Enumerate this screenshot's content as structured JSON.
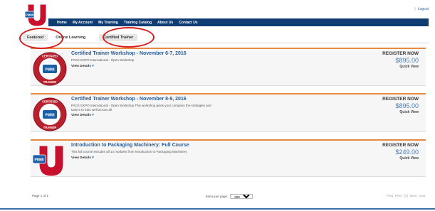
{
  "header": {
    "logout_label": "Logout",
    "nav": [
      {
        "label": "Home"
      },
      {
        "label": "My Account"
      },
      {
        "label": "My Training"
      },
      {
        "label": "Training Catalog"
      },
      {
        "label": "About Us"
      },
      {
        "label": "Contact Us"
      }
    ]
  },
  "tabs": [
    {
      "label": "Featured",
      "active": true
    },
    {
      "label": "Online Learning",
      "active": false
    },
    {
      "label": "Certified Trainer",
      "active": false
    }
  ],
  "courses": [
    {
      "title": "Certified Trainer Workshop - November 6-7, 2016",
      "description": "PACK EXPO International - Open Workshop",
      "view_details": "View Details",
      "register": "REGISTER NOW",
      "price": "$895.00",
      "quick_view": "Quick View",
      "badge": "certified-trainer"
    },
    {
      "title": "Certified Trainer Workshop - November 8-9, 2016",
      "description": "PACK EXPO International - Open Workshop This workshop gives your company the strategies and tactics to train well across all",
      "view_details": "View Details",
      "register": "REGISTER NOW",
      "price": "$895.00",
      "quick_view": "Quick View",
      "badge": "certified-trainer"
    },
    {
      "title": "Introduction to Packaging Machinery: Full Course",
      "description": "This full course includes all 14 modules from Introduction to Packaging Machinery",
      "view_details": "View Details",
      "register": "REGISTER NOW",
      "price": "$249.00",
      "quick_view": "Quick View",
      "badge": "pmmi-u"
    }
  ],
  "badge_text": {
    "certified": "CERTIFIED",
    "trainer": "TRAINER",
    "pmmi": "PMMI"
  },
  "pagination": {
    "page_of": "Page 1 of 1",
    "items_per_page_label": "Items per page:",
    "items_per_page_value": "200",
    "links": [
      "First",
      "Prev",
      "[1]",
      "Next",
      "Last"
    ]
  },
  "colors": {
    "nav_bg": "#0f3d73",
    "card_accent": "#e58a40",
    "title_blue": "#2a5b93",
    "price_blue": "#4a7bb5",
    "annotation_red": "#d61f1f",
    "logo_red": "#c8102e"
  }
}
